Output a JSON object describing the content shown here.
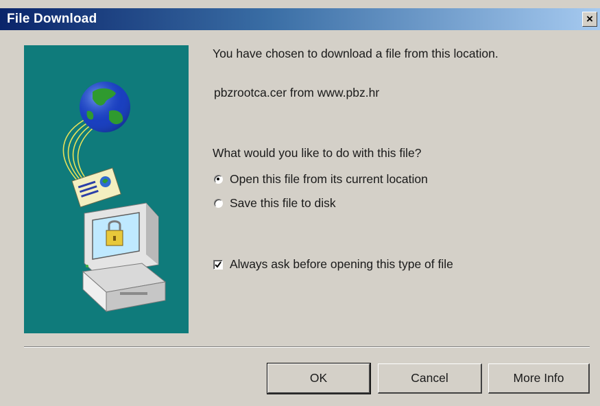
{
  "window": {
    "title": "File Download",
    "close_label": "×"
  },
  "message": {
    "line1": "You have chosen to download a file from this location.",
    "file": "pbzrootca.cer from www.pbz.hr",
    "question": "What would you like to do with this file?"
  },
  "options": [
    {
      "label": "Open this file from its current location",
      "selected": true
    },
    {
      "label": "Save this file to disk",
      "selected": false
    }
  ],
  "always_ask": {
    "label": "Always ask before opening this type of file",
    "checked": true
  },
  "buttons": {
    "ok": "OK",
    "cancel": "Cancel",
    "more_info": "More Info"
  },
  "colors": {
    "dialog_bg": "#d4d0c8",
    "title_start": "#0a246a",
    "title_end": "#a6caf0",
    "illustration_bg": "#0f7b7b"
  }
}
